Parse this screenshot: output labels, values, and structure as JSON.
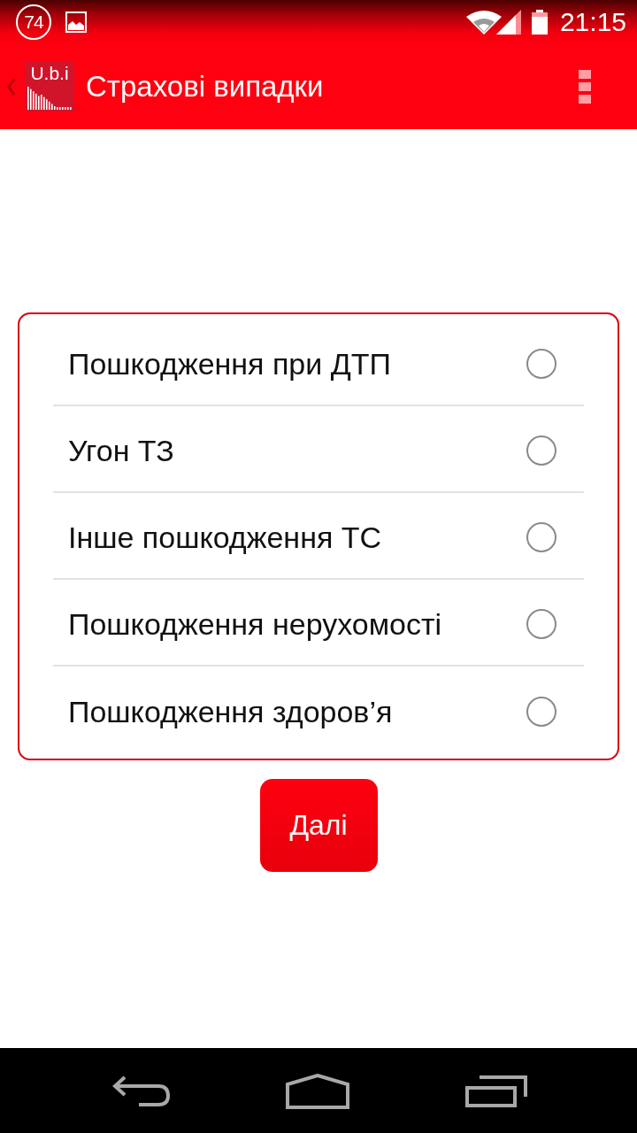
{
  "status_bar": {
    "notification_count": "74",
    "time": "21:15"
  },
  "app_bar": {
    "logo_text": "U.b.i",
    "title": "Страхові випадки"
  },
  "options": [
    {
      "label": "Пошкодження при ДТП",
      "selected": false
    },
    {
      "label": "Угон ТЗ",
      "selected": false
    },
    {
      "label": "Інше пошкодження ТС",
      "selected": false
    },
    {
      "label": "Пошкодження нерухомості",
      "selected": false
    },
    {
      "label": "Пошкодження здоров’я",
      "selected": false
    }
  ],
  "next_button": {
    "label": "Далі"
  }
}
